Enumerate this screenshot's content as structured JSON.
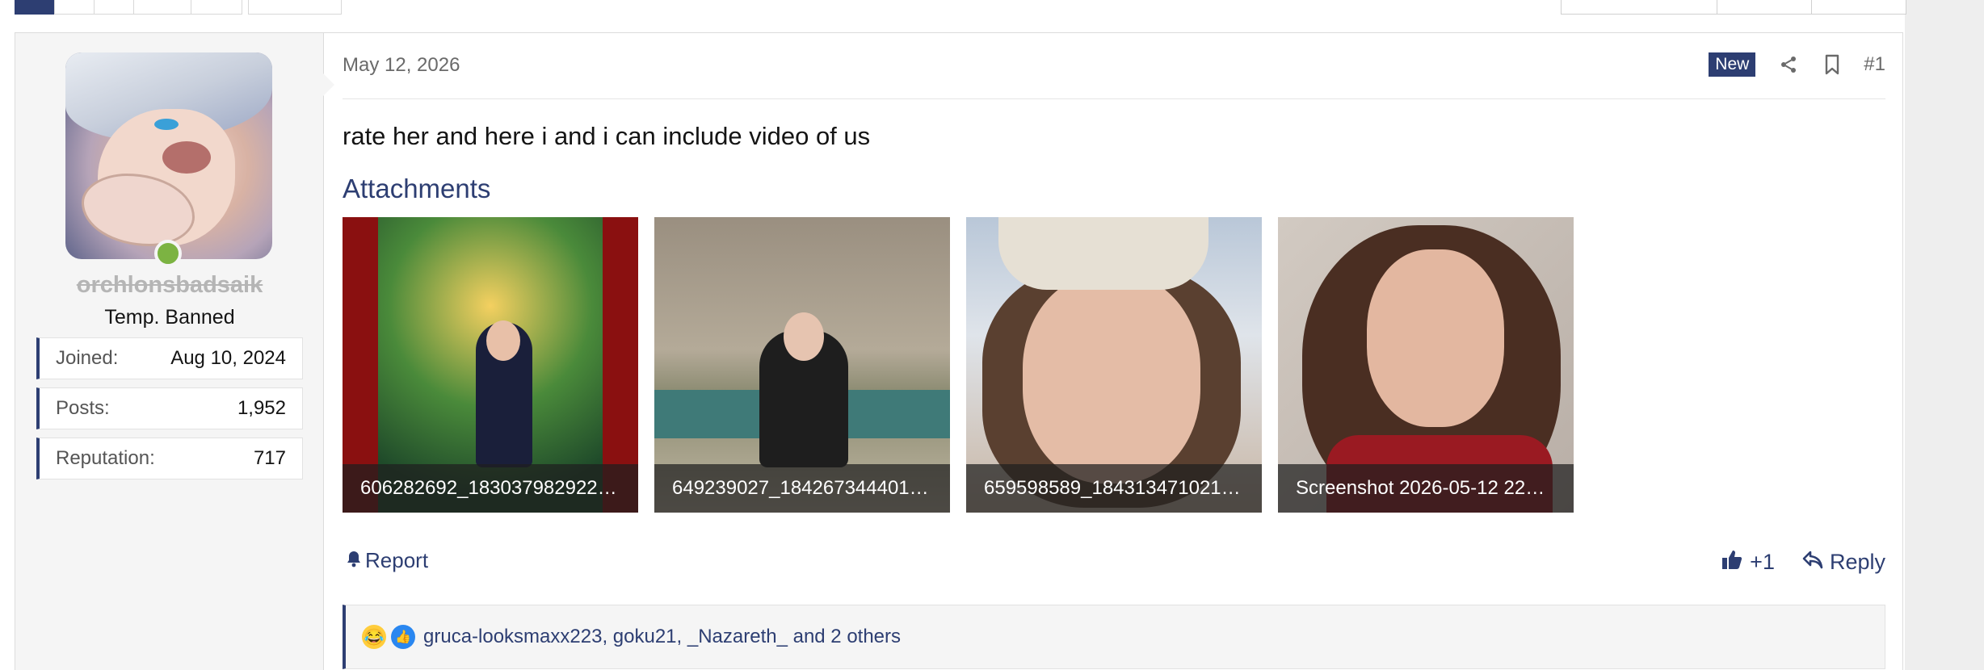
{
  "pagination": {
    "pages": [
      "",
      "",
      "",
      "",
      ""
    ],
    "jump_label": ""
  },
  "user": {
    "username": "orchlonsbadsaik",
    "title": "Temp. Banned",
    "online": true,
    "stats": [
      {
        "label": "Joined:",
        "value": "Aug 10, 2024"
      },
      {
        "label": "Posts:",
        "value": "1,952"
      },
      {
        "label": "Reputation:",
        "value": "717"
      }
    ]
  },
  "post": {
    "date": "May 12, 2026",
    "badge": "New",
    "number": "#1",
    "body": "rate her and here i and i can include video of us",
    "attachments_title": "Attachments",
    "attachments": [
      {
        "name": "606282692_183037982922…"
      },
      {
        "name": "649239027_184267344401…"
      },
      {
        "name": "659598589_184313471021…"
      },
      {
        "name": "Screenshot 2026-05-12 22…"
      }
    ],
    "actions": {
      "report": "Report",
      "like": "+1",
      "reply": "Reply"
    },
    "reactions_text": "gruca-looksmaxx223, goku21, _Nazareth_ and 2 others"
  },
  "colors": {
    "accent": "#2d3e72",
    "online": "#7cb342",
    "banned_name": "#b5b5b5"
  },
  "icons": [
    "share-icon",
    "bookmark-icon",
    "bell-icon",
    "thumbs-up-icon",
    "reply-icon",
    "laugh-reaction-icon",
    "like-reaction-icon"
  ]
}
